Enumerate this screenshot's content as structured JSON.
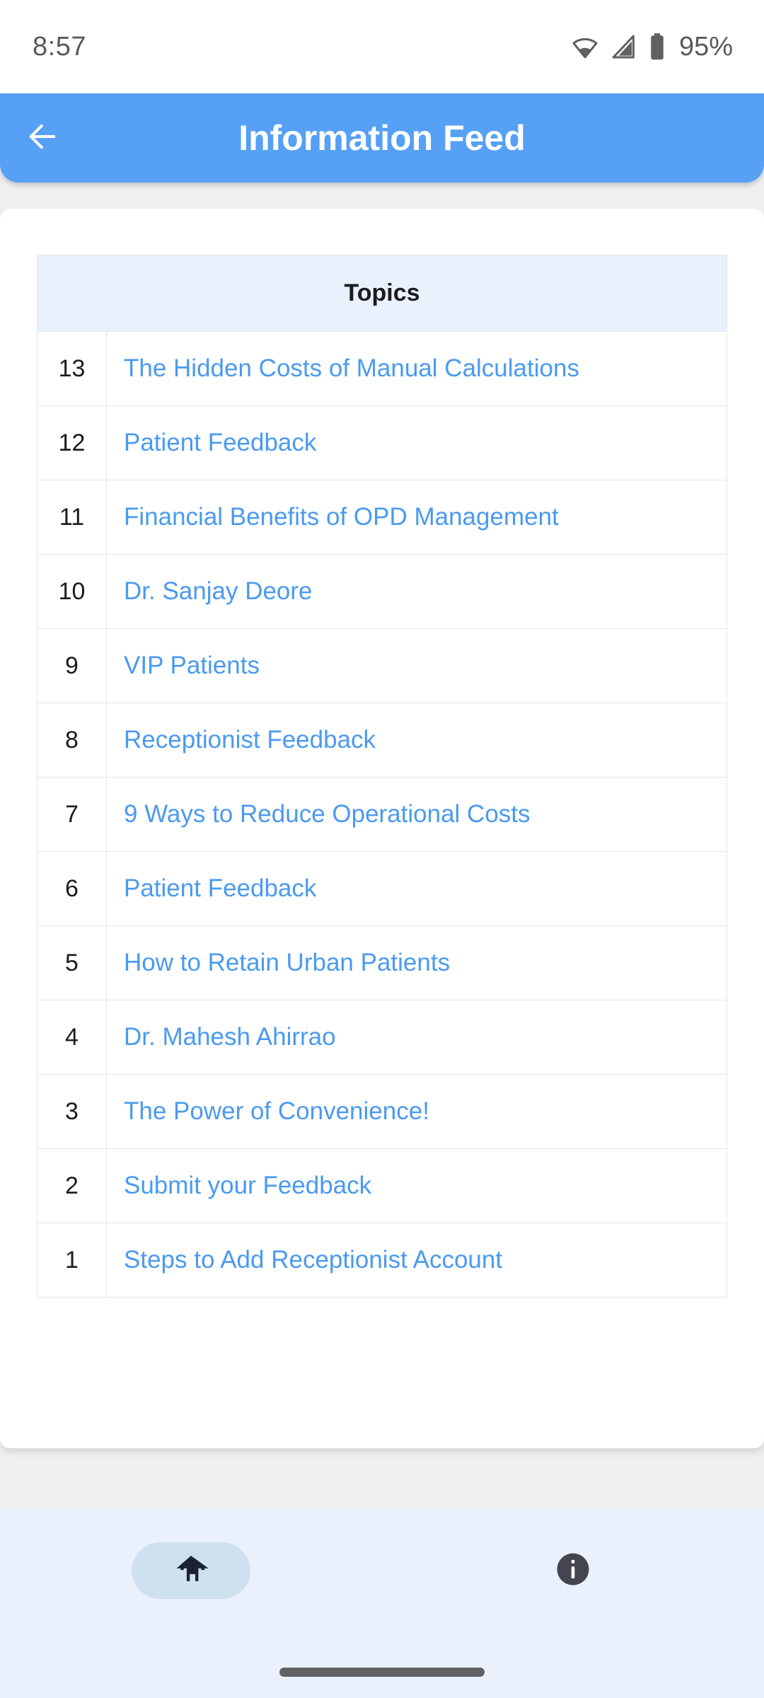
{
  "status_bar": {
    "time": "8:57",
    "battery_percent": "95%",
    "wifi_icon": "wifi-icon",
    "signal_icon": "cellular-signal-icon",
    "battery_icon": "battery-icon"
  },
  "app_bar": {
    "title": "Information Feed",
    "back_icon": "back-arrow-icon",
    "background_color": "#56a0f5"
  },
  "table": {
    "header": "Topics",
    "header_background": "#e8f1fc",
    "link_color": "#4a9af0",
    "rows": [
      {
        "num": "13",
        "topic": "The Hidden Costs of Manual Calculations"
      },
      {
        "num": "12",
        "topic": "Patient Feedback"
      },
      {
        "num": "11",
        "topic": "Financial Benefits of OPD Management"
      },
      {
        "num": "10",
        "topic": "Dr. Sanjay Deore"
      },
      {
        "num": "9",
        "topic": "VIP Patients"
      },
      {
        "num": "8",
        "topic": "Receptionist Feedback"
      },
      {
        "num": "7",
        "topic": "9 Ways to Reduce Operational Costs"
      },
      {
        "num": "6",
        "topic": "Patient Feedback"
      },
      {
        "num": "5",
        "topic": "How to Retain Urban Patients"
      },
      {
        "num": "4",
        "topic": "Dr. Mahesh Ahirrao"
      },
      {
        "num": "3",
        "topic": "The Power of Convenience!"
      },
      {
        "num": "2",
        "topic": "Submit your Feedback"
      },
      {
        "num": "1",
        "topic": "Steps to Add Receptionist Account"
      }
    ]
  },
  "bottom_nav": {
    "background_color": "#eaf1fd",
    "items": [
      {
        "name": "home",
        "icon": "home-icon",
        "selected": true
      },
      {
        "name": "info",
        "icon": "info-icon",
        "selected": false
      }
    ]
  }
}
